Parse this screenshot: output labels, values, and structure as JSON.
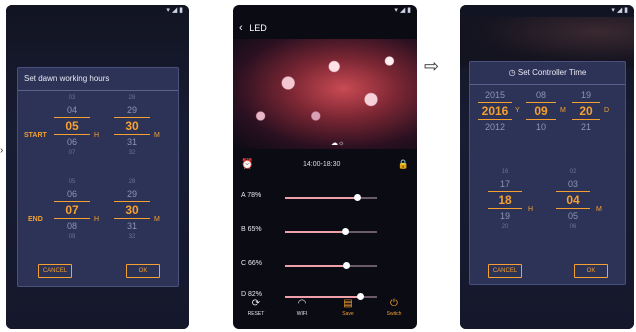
{
  "screen1": {
    "title": "Set dawn working hours",
    "start_label": "START",
    "end_label": "END",
    "start_hour": {
      "above_faint": "03",
      "above": "04",
      "selected": "05",
      "below": "06",
      "below_faint": "07"
    },
    "start_min": {
      "above_faint": "28",
      "above": "29",
      "selected": "30",
      "below": "31",
      "below_faint": "32"
    },
    "end_hour": {
      "above_faint": "05",
      "above": "06",
      "selected": "07",
      "below": "08",
      "below_faint": "09"
    },
    "end_min": {
      "above_faint": "28",
      "above": "29",
      "selected": "30",
      "below": "31",
      "below_faint": "32"
    },
    "unit_hour": "H",
    "unit_min": "M",
    "cancel_label": "CANCEL",
    "ok_label": "OK"
  },
  "screen2": {
    "back_icon": "chevron-left-icon",
    "title": "LED",
    "time_range": "14:00-18:30",
    "sliders": [
      {
        "label": "A 78%",
        "value": 78
      },
      {
        "label": "B 65%",
        "value": 65
      },
      {
        "label": "C 66%",
        "value": 66
      },
      {
        "label": "D 82%",
        "value": 82
      }
    ],
    "nav": [
      {
        "label": "RESET",
        "icon": "refresh-icon"
      },
      {
        "label": "WIFI",
        "icon": "wifi-icon"
      },
      {
        "label": "Save",
        "icon": "save-icon"
      },
      {
        "label": "Switch",
        "icon": "power-icon"
      }
    ]
  },
  "screen3": {
    "title": "Set Controller Time",
    "year": {
      "above": "2015",
      "selected": "2016",
      "below": "2012"
    },
    "month": {
      "above": "08",
      "selected": "09",
      "below": "10"
    },
    "day": {
      "above": "19",
      "selected": "20",
      "below": "21"
    },
    "hour": {
      "above_faint": "16",
      "above": "17",
      "selected": "18",
      "below": "19",
      "below_faint": "20"
    },
    "minute": {
      "above_faint": "02",
      "above": "03",
      "selected": "04",
      "below": "05",
      "below_faint": "06"
    },
    "unit_year": "Y",
    "unit_month": "M",
    "unit_day": "D",
    "unit_hour": "H",
    "unit_min": "M",
    "cancel_label": "CANCEL",
    "ok_label": "OK"
  },
  "colors": {
    "accent": "#f5a030",
    "dialog": "#2d3357",
    "background": "#0b0b14"
  }
}
